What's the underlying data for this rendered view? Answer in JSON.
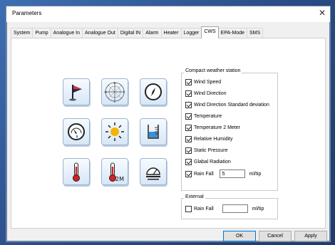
{
  "window": {
    "title": "Parameters",
    "close": "✕"
  },
  "tabs": [
    "System",
    "Pump",
    "Analogue In",
    "Analogue Out",
    "Digital IN",
    "Alarm",
    "Heater",
    "Logger",
    "CWS",
    "EPA-Mode",
    "SMS"
  ],
  "active_tab": "CWS",
  "icons": [
    "wind-flag-icon",
    "wind-rose-icon",
    "compass-icon",
    "gauge-icon",
    "sun-icon",
    "humidity-icon",
    "thermometer-icon",
    "thermometer-2m-icon",
    "pressure-icon"
  ],
  "icon_labels": {
    "thermo2m": "2M"
  },
  "cws_group": {
    "label": "Compact weather station",
    "items": [
      {
        "label": "Wind Speed",
        "checked": true
      },
      {
        "label": "Wind Direction",
        "checked": true
      },
      {
        "label": "Wind Direction Standard deviation",
        "checked": true
      },
      {
        "label": "Temperature",
        "checked": true
      },
      {
        "label": "Temperature 2 Meter",
        "checked": true
      },
      {
        "label": "Relative Humidity",
        "checked": true
      },
      {
        "label": "Static Pressure",
        "checked": true
      },
      {
        "label": "Glabal Radiation",
        "checked": true
      }
    ],
    "rain": {
      "label": "Rain Fall",
      "checked": true,
      "value": "5",
      "unit": "ml/tip"
    }
  },
  "external_group": {
    "label": "External",
    "rain": {
      "label": "Rain Fall",
      "checked": false,
      "value": "",
      "unit": "ml/tip"
    }
  },
  "buttons": {
    "ok": "OK",
    "cancel": "Cancel",
    "apply": "Apply"
  }
}
